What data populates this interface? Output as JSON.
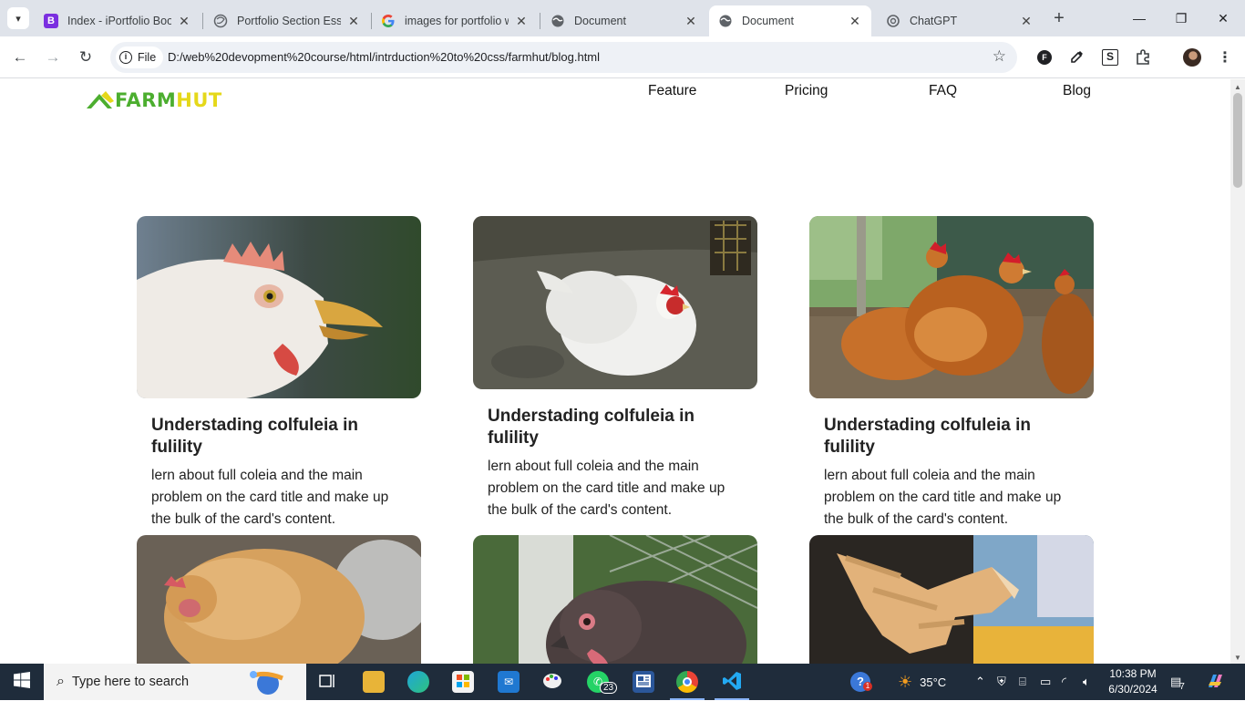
{
  "browser": {
    "tabs": [
      {
        "title": "Index - iPortfolio Boo",
        "favicon_label": "B",
        "favicon_color": "#7b2fe0"
      },
      {
        "title": "Portfolio Section Esse",
        "favicon_label": "",
        "favicon_color": "#5f6368"
      },
      {
        "title": "images for portfolio w",
        "favicon_label": "G",
        "favicon_color": "#4285f4"
      },
      {
        "title": "Document",
        "favicon_label": "",
        "favicon_color": "#5f6368"
      },
      {
        "title": "Document",
        "favicon_label": "",
        "favicon_color": "#5f6368"
      },
      {
        "title": "ChatGPT",
        "favicon_label": "",
        "favicon_color": "#5f6368"
      }
    ],
    "active_tab": 4,
    "close_glyph": "✕",
    "new_tab_glyph": "+",
    "address": {
      "scheme_label": "File",
      "url": "D:/web%20devopment%20course/html/intrduction%20to%20css/farmhut/blog.html"
    },
    "extensions": [
      "F",
      "S"
    ]
  },
  "site": {
    "logo": {
      "part1": "FARM",
      "part2": "HUT"
    },
    "nav": [
      "Feature",
      "Pricing",
      "FAQ",
      "Blog"
    ],
    "cards": [
      {
        "title": "Understading colfuleia in fulility",
        "text": "lern about full coleia and the main problem on the card title and make up the bulk of the card's content.",
        "image": "white chicken head close-up"
      },
      {
        "title": "Understading colfuleia in fulility",
        "text": "lern about full coleia and the main problem on the card title and make up the bulk of the card's content.",
        "image": "white hen sitting on concrete floor"
      },
      {
        "title": "Understading colfuleia in fulility",
        "text": "lern about full coleia and the main problem on the card title and make up the bulk of the card's content.",
        "image": "brown hens in a coop"
      },
      {
        "title": "",
        "text": "",
        "image": "brown hen resting"
      },
      {
        "title": "",
        "text": "",
        "image": "dark hen close-up"
      },
      {
        "title": "",
        "text": "",
        "image": "chicken foot close-up"
      }
    ]
  },
  "taskbar": {
    "search_placeholder": "Type here to search",
    "whatsapp_badge": "23",
    "weather": "35°C",
    "time": "10:38 PM",
    "date": "6/30/2024",
    "notifications": "7",
    "help_badge": "1"
  },
  "colors": {
    "farm_green": "#4cae2f",
    "hut_yellow": "#e5d81a",
    "taskbar_bg": "#1f2c3b"
  }
}
